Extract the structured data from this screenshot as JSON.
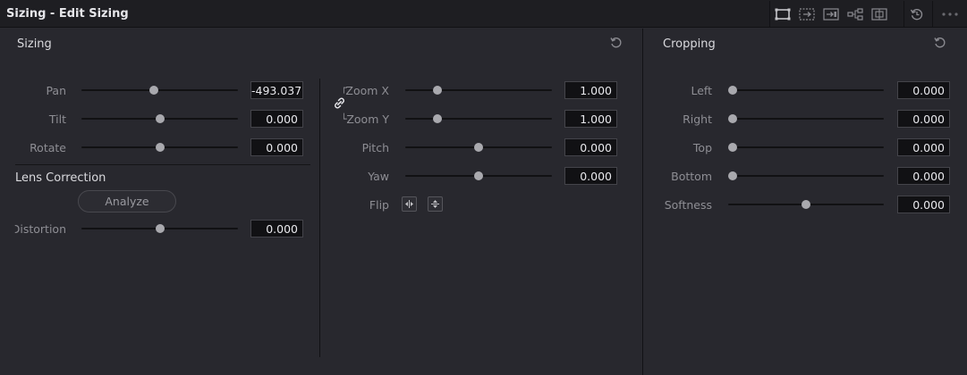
{
  "window": {
    "title": "Sizing - Edit Sizing"
  },
  "toolbar": {
    "icons": [
      "edit-sizing-icon",
      "output-sizing-icon",
      "input-sizing-icon",
      "node-sizing-icon",
      "image-stabilization-icon",
      "reset-icon",
      "more-options-icon"
    ],
    "more_label": "•••"
  },
  "sizing": {
    "title": "Sizing",
    "pan": {
      "label": "Pan",
      "value": "-493.037",
      "level": 0.46
    },
    "tilt": {
      "label": "Tilt",
      "value": "0.000",
      "level": 0.5
    },
    "rotate": {
      "label": "Rotate",
      "value": "0.000",
      "level": 0.5
    },
    "zoom_x": {
      "label": "Zoom X",
      "value": "1.000",
      "level": 0.2
    },
    "zoom_y": {
      "label": "Zoom Y",
      "value": "1.000",
      "level": 0.2
    },
    "pitch": {
      "label": "Pitch",
      "value": "0.000",
      "level": 0.5
    },
    "yaw": {
      "label": "Yaw",
      "value": "0.000",
      "level": 0.5
    },
    "flip": {
      "label": "Flip"
    }
  },
  "lens_correction": {
    "title": "Lens Correction",
    "analyze_label": "Analyze",
    "distortion": {
      "label": "Distortion",
      "value": "0.000",
      "level": 0.5
    }
  },
  "cropping": {
    "title": "Cropping",
    "left": {
      "label": "Left",
      "value": "0.000",
      "level": 0
    },
    "right": {
      "label": "Right",
      "value": "0.000",
      "level": 0
    },
    "top": {
      "label": "Top",
      "value": "0.000",
      "level": 0
    },
    "bottom": {
      "label": "Bottom",
      "value": "0.000",
      "level": 0
    },
    "softness": {
      "label": "Softness",
      "value": "0.000",
      "level": 0.5
    }
  }
}
